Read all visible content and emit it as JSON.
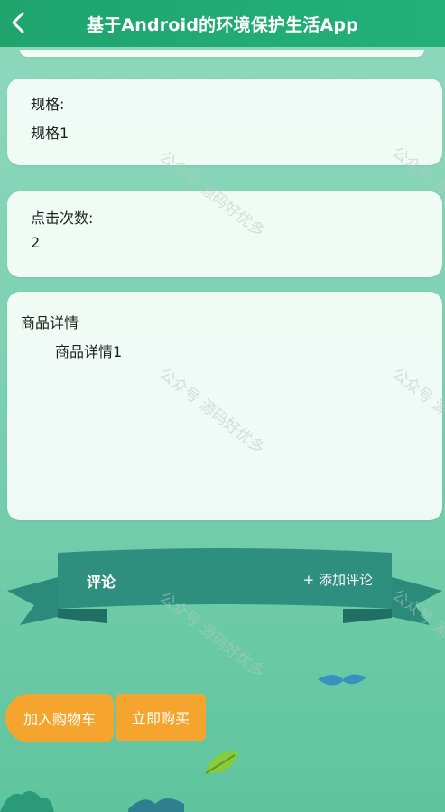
{
  "header": {
    "title": "基于Android的环境保护生活App"
  },
  "spec": {
    "label": "规格:",
    "value": "规格1"
  },
  "clicks": {
    "label": "点击次数:",
    "value": "2"
  },
  "detail": {
    "label": "商品详情",
    "value": "商品详情1"
  },
  "comments": {
    "label": "评论",
    "add_label": "+ 添加评论"
  },
  "actions": {
    "cart_label": "加入购物车",
    "buy_label": "立即购买"
  },
  "watermark": {
    "text": "公众号 源码好优多"
  },
  "colors": {
    "header": "#1fa46e",
    "ribbon": "#2f8f7e",
    "button": "#f5a52e"
  }
}
